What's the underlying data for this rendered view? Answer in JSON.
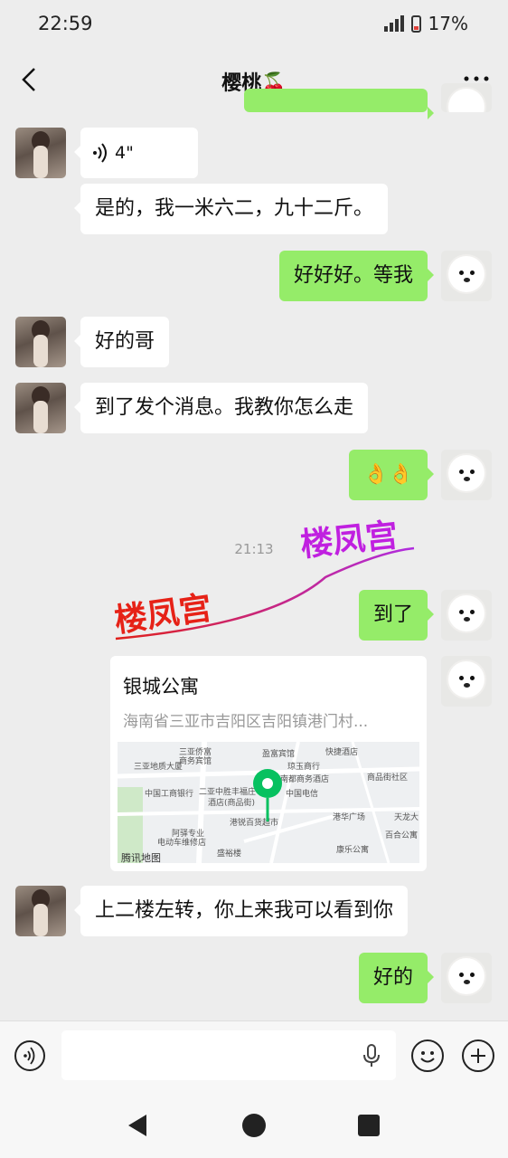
{
  "status": {
    "time": "22:59",
    "battery": "17%"
  },
  "header": {
    "title": "樱桃🍒"
  },
  "messages": {
    "voice_duration": "4\"",
    "m1": "是的，我一米六二，九十二斤。",
    "m2": "好好好。等我",
    "m3": "好的哥",
    "m4": "到了发个消息。我教你怎么走",
    "m5": "👌👌",
    "time_divider": "21:13",
    "m6": "到了",
    "m7": "上二楼左转，你上来我可以看到你",
    "m8": "好的"
  },
  "location": {
    "title": "银城公寓",
    "address": "海南省三亚市吉阳区吉阳镇港门村...",
    "map_provider": "腾讯地图",
    "map_labels": [
      "三亚侨富",
      "商务宾馆",
      "盈富宾馆",
      "快捷酒店",
      "三亚地质大厦",
      "琼玉商行",
      "南都商务酒店",
      "商品街社区",
      "中国工商银行",
      "二亚中胜丰福庄",
      "酒店(商品街)",
      "中国电信",
      "港华广场",
      "天龙大",
      "阿驿专业",
      "电动车维修店",
      "港锐百货超市",
      "盛裕楼",
      "康乐公寓",
      "百合公寓"
    ]
  },
  "watermark": {
    "text1": "楼凤宫",
    "text2": "楼凤宫"
  },
  "colors": {
    "outgoing_bubble": "#95ec69",
    "incoming_bubble": "#ffffff",
    "background": "#ededed",
    "map_pin": "#07c160"
  }
}
